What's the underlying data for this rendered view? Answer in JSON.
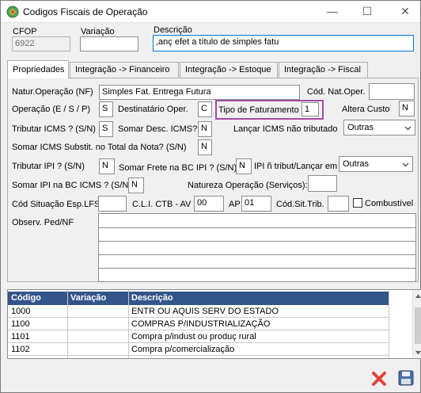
{
  "window": {
    "title": "Codigos Fiscais de Operação"
  },
  "header": {
    "cfop_label": "CFOP",
    "cfop_value": "6922",
    "variacao_label": "Variação",
    "variacao_value": "",
    "descricao_label": "Descrição",
    "descricao_value": ",anç efet a título de simples fatu"
  },
  "tabs": [
    {
      "label": "Propriedades"
    },
    {
      "label": "Integração -> Financeiro"
    },
    {
      "label": "Integração -> Estoque"
    },
    {
      "label": "Integração -> Fiscal"
    }
  ],
  "form": {
    "natur_label": "Natur.Operação (NF)",
    "natur_value": "Simples Fat. Entrega Futura",
    "cod_nat_label": "Cód. Nat.Oper.",
    "cod_nat_value": "",
    "operacao_label": "Operação (E / S / P)",
    "operacao_value": "S",
    "destinatario_label": "Destinatário Oper.",
    "destinatario_value": "C",
    "tipo_fat_label": "Tipo de Faturamento",
    "tipo_fat_value": "1",
    "altera_custo_label": "Altera Custo",
    "altera_custo_value": "N",
    "tributar_icms_label": "Tributar ICMS ? (S/N)",
    "tributar_icms_value": "S",
    "somar_desc_label": "Somar Desc. ICMS?",
    "somar_desc_value": "N",
    "lancar_icms_label": "Lançar ICMS não tributado",
    "lancar_icms_value": "Outras",
    "somar_icms_st_label": "Somar ICMS Substit. no Total da Nota? (S/N)",
    "somar_icms_st_value": "N",
    "tributar_ipi_label": "Tributar IPI ? (S/N)",
    "tributar_ipi_value": "N",
    "somar_frete_label": "Somar Frete na BC IPI ? (S/N)",
    "somar_frete_value": "N",
    "ipi_ntrib_label": "IPI ñ tribut/Lançar em",
    "ipi_ntrib_value": "Outras",
    "somar_ipi_bc_label": "Somar IPI na BC ICMS ? (S/N)",
    "somar_ipi_bc_value": "N",
    "natureza_label": "Natureza Operação (Serviços):",
    "natureza_value": "",
    "cod_sit_lfs_label": "Cód Situação Esp.LFS",
    "cod_sit_lfs_value": "",
    "cli_ctb_label": "C.L.I. CTB - AV",
    "cli_ctb_value": "00",
    "ap_label": "AP",
    "ap_value": "01",
    "cod_sit_trib_label": "Cód.Sit.Trib.",
    "cod_sit_trib_value": "",
    "combustivel_label": "Combustível",
    "observ_label": "Observ. Ped/NF"
  },
  "table": {
    "headers": [
      "Código",
      "Variação",
      "Descrição"
    ],
    "rows": [
      {
        "codigo": "1000",
        "variacao": "",
        "descricao": "ENTR OU AQUIS SERV DO ESTADO"
      },
      {
        "codigo": "1100",
        "variacao": "",
        "descricao": "COMPRAS P/INDUSTRIALIZAÇÃO"
      },
      {
        "codigo": "1101",
        "variacao": "",
        "descricao": "Compra p/indust ou produç rural"
      },
      {
        "codigo": "1102",
        "variacao": "",
        "descricao": "Compra p/comercialização"
      }
    ]
  },
  "colors": {
    "highlight": "#a54aa5",
    "table_header": "#34558a",
    "cancel": "#e0463c",
    "save": "#4a6fa5"
  },
  "icons": [
    "app-icon",
    "cancel-icon",
    "save-icon"
  ]
}
